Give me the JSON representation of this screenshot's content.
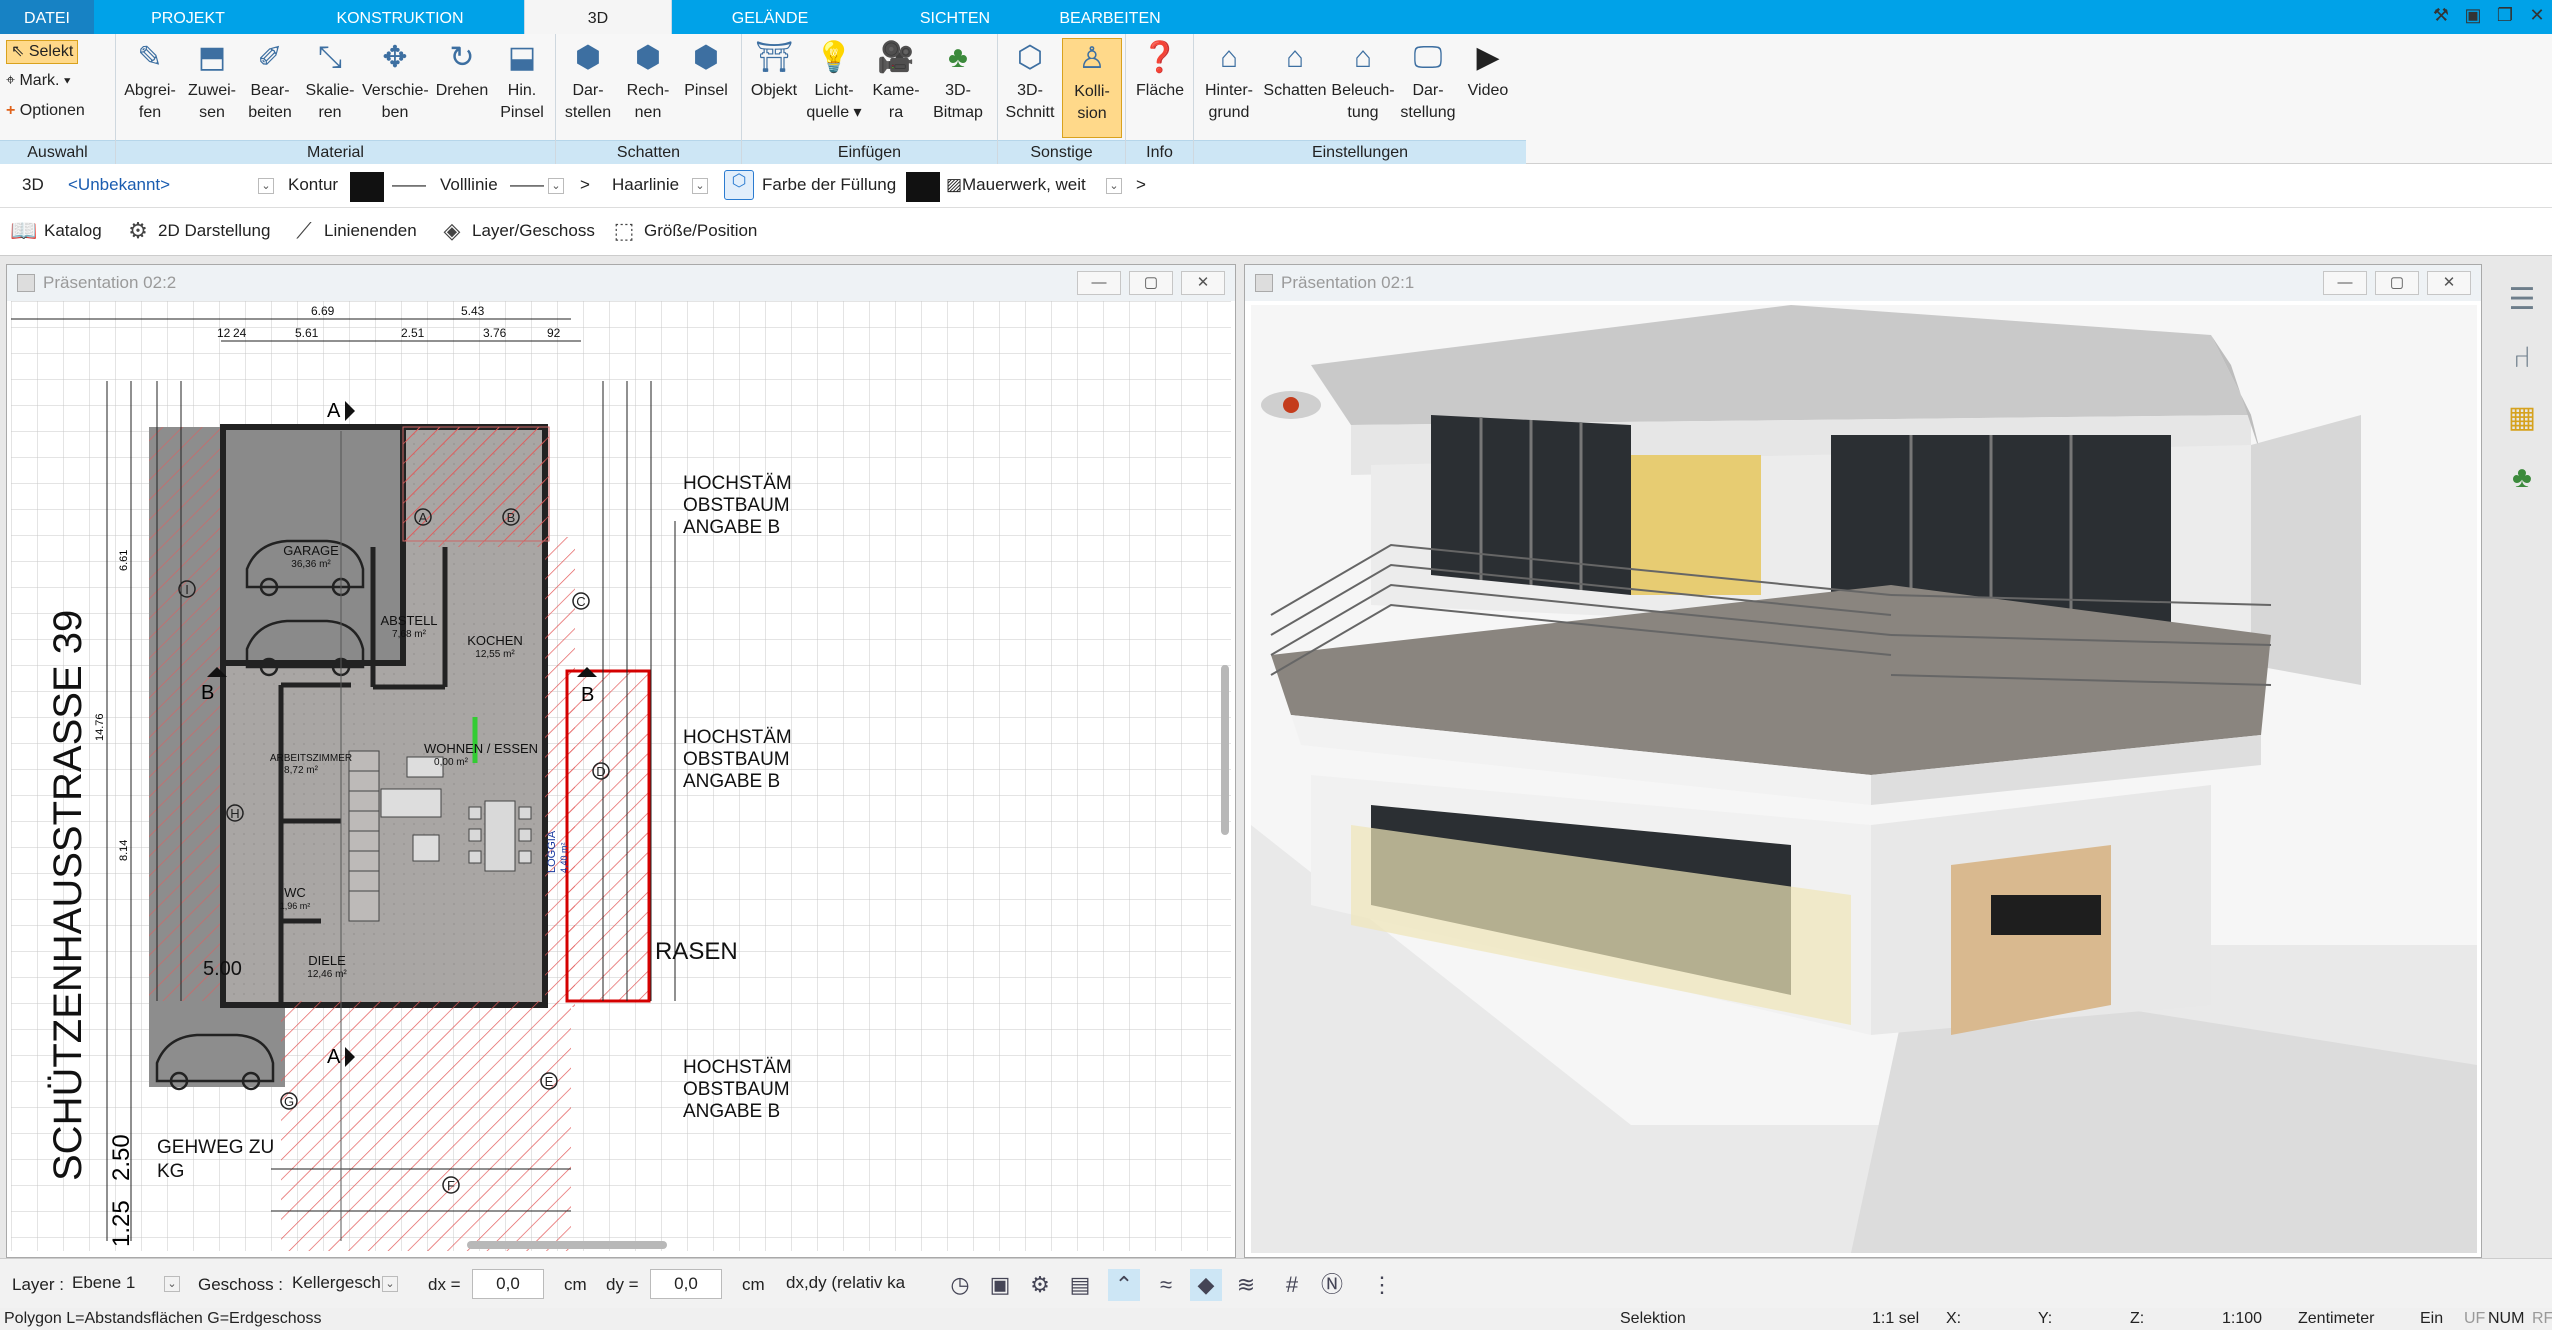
{
  "tabs": [
    "DATEI",
    "PROJEKT",
    "KONSTRUKTION",
    "3D",
    "GELÄNDE",
    "SICHTEN",
    "BEARBEITEN"
  ],
  "window_icons": [
    "tools-icon",
    "save-icon",
    "restore-icon",
    "close-icon"
  ],
  "ribbon": {
    "auswahl": {
      "label": "Auswahl",
      "items": [
        "Selekt",
        "Mark.",
        "Optionen"
      ]
    },
    "material": {
      "label": "Material",
      "buttons": [
        "Abgrei-\nfen",
        "Zuwei-\nsen",
        "Bear-\nbeiten",
        "Skalie-\nren",
        "Verschie-\nben",
        "Drehen",
        "Hin.\nPinsel"
      ]
    },
    "schatten": {
      "label": "Schatten",
      "buttons": [
        "Dar-\nstellen",
        "Rech-\nnen",
        "Pinsel"
      ]
    },
    "einfuegen": {
      "label": "Einfügen",
      "buttons": [
        "Objekt",
        "Licht-\nquelle ▾",
        "Kame-\nra",
        "3D-\nBitmap"
      ]
    },
    "sonstige": {
      "label": "Sonstige",
      "buttons": [
        "3D-\nSchnitt",
        "Kolli-\nsion"
      ]
    },
    "info": {
      "label": "Info",
      "buttons": [
        "Fläche"
      ]
    },
    "einstellungen": {
      "label": "Einstellungen",
      "buttons": [
        "Hinter-\ngrund",
        "Schatten",
        "Beleuch-\ntung",
        "Dar-\nstellung",
        "Video"
      ]
    }
  },
  "props": {
    "mode": "3D",
    "layer": "<Unbekannt>",
    "kontur": "Kontur",
    "linetype": "Volllinie",
    "more1": ">",
    "width": "Haarlinie",
    "fill_label": "Farbe der Füllung",
    "hatch": "Mauerwerk, weit",
    "more2": ">"
  },
  "toolbar2": [
    "Katalog",
    "2D Darstellung",
    "Linienenden",
    "Layer/Geschoss",
    "Größe/Position"
  ],
  "pane_left": {
    "title": "Präsentation 02:2"
  },
  "pane_right": {
    "title": "Präsentation 02:1"
  },
  "plan": {
    "street": "SCHÜTZENHAUSSTRASSE 39",
    "rooms": [
      {
        "name": "GARAGE",
        "area": "36,36 m²"
      },
      {
        "name": "ABSTELL",
        "area": "7,68 m²"
      },
      {
        "name": "KOCHEN",
        "area": "12,55 m²"
      },
      {
        "name": "ARBEITSZIMMER",
        "area": "8,72 m²"
      },
      {
        "name": "WOHNEN / ESSEN",
        "area": "0,00 m²"
      },
      {
        "name": "WC",
        "area": "1,96 m²"
      },
      {
        "name": "DIELE",
        "area": "12,46 m²"
      },
      {
        "name": "LOGGIA",
        "area": "4,40 m²"
      }
    ],
    "labels": [
      "RASEN",
      "GEHWEG ZU",
      "KG",
      "HOCHSTÄM",
      "OBSTBAUM",
      "ANGABE B"
    ],
    "markers": [
      "A",
      "B",
      "C",
      "D",
      "E",
      "F",
      "G",
      "H",
      "I"
    ],
    "dims_top": [
      "6.69",
      "5.43",
      "5.61",
      "2.51",
      "3.76",
      "92",
      "12",
      "24"
    ],
    "dims_left": [
      "2.50",
      "1.25",
      "14.76",
      "8.14",
      "6.61"
    ],
    "dim_500": "5.00"
  },
  "status": {
    "layer_label": "Layer :",
    "layer": "Ebene 1",
    "geschoss_label": "Geschoss :",
    "geschoss": "Kellergesch",
    "dx_label": "dx =",
    "dx": "0,0",
    "cm1": "cm",
    "dy_label": "dy =",
    "dy": "0,0",
    "cm2": "cm",
    "rel": "dx,dy (relativ ka"
  },
  "bottom": {
    "left": "Polygon L=Abstandsflächen G=Erdgeschoss",
    "mode": "Selektion",
    "sel": "1:1 sel",
    "x": "X:",
    "y": "Y:",
    "z": "Z:",
    "scale": "1:100",
    "unit": "Zentimeter",
    "ein": "Ein",
    "uf": "UF",
    "num": "NUM",
    "rf": "RF"
  }
}
